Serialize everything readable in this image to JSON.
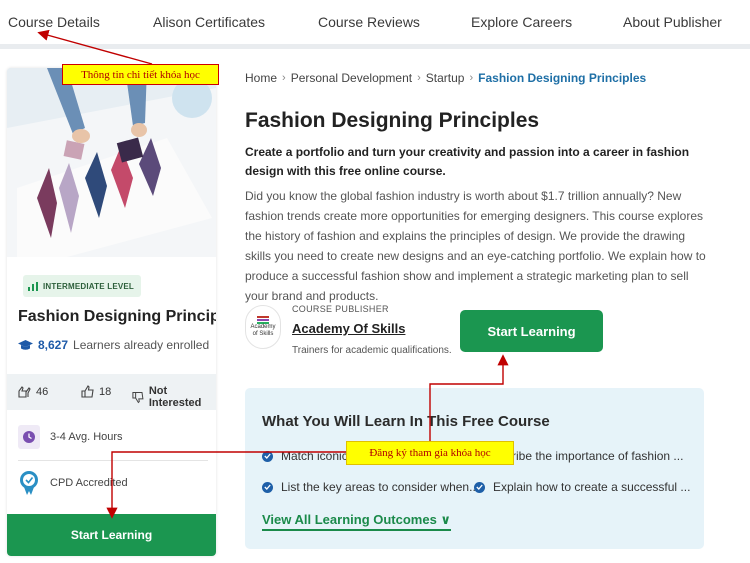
{
  "topnav": {
    "tabs": [
      {
        "label": "Course Details"
      },
      {
        "label": "Alison Certificates"
      },
      {
        "label": "Course Reviews"
      },
      {
        "label": "Explore Careers"
      },
      {
        "label": "About Publisher"
      }
    ]
  },
  "card": {
    "level": "INTERMEDIATE LEVEL",
    "title": "Fashion Designing Principles",
    "enrolled_count": "8,627",
    "enrolled_label": "Learners already enrolled",
    "likes": "46",
    "thumbs_up": "18",
    "not_interested": "Not Interested",
    "hours": "3-4 Avg. Hours",
    "accreditation": "CPD Accredited",
    "start_label": "Start Learning"
  },
  "breadcrumb": [
    "Home",
    "Personal Development",
    "Startup",
    "Fashion Designing Principles"
  ],
  "course": {
    "title": "Fashion Designing Principles",
    "subtitle": "Create a portfolio and turn your creativity and passion into a career in fashion design with this free online course.",
    "description": "Did you know the global fashion industry is worth about $1.7 trillion annually? New fashion trends create more opportunities for emerging designers. This course explores the history of fashion and explains the principles of design. We provide the drawing skills you need to create new designs and an eye-catching portfolio. We explain how to produce a successful fashion show and implement a strategic marketing plan to sell your brand and products."
  },
  "publisher": {
    "label": "COURSE PUBLISHER",
    "name": "Academy Of Skills",
    "tagline": "Trainers for academic qualifications.",
    "logo_text_1": "Academy",
    "logo_text_2": "of Skills"
  },
  "main_start_label": "Start Learning",
  "learn": {
    "title": "What You Will Learn In This Free Course",
    "items": [
      "Match iconic fa",
      "ribe the importance of fashion ...",
      "List the key areas to consider when...",
      "Explain how to create a successful ..."
    ],
    "view_all": "View All Learning Outcomes ∨"
  },
  "annotations": {
    "note_1": "Thông  tin  chi  tiết  khóa  học",
    "note_2": "Đăng  ký  tham  gia  khóa  học"
  },
  "colors": {
    "accent_green": "#1b9650",
    "link_blue": "#1e6fa6",
    "annotation_red": "#c00000",
    "annotation_yellow": "#ffff00"
  }
}
